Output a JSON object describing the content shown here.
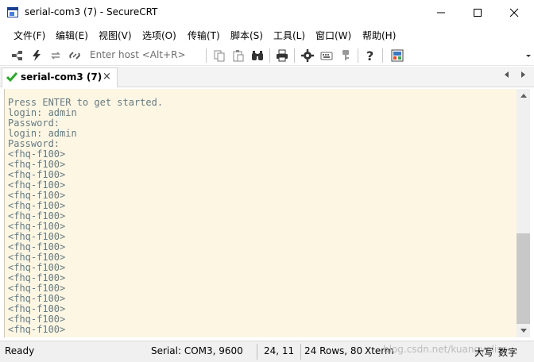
{
  "window": {
    "title": "serial-com3 (7) - SecureCRT",
    "minimize_icon": "minimize-icon",
    "maximize_icon": "maximize-icon",
    "close_icon": "close-icon"
  },
  "menu": {
    "items": [
      {
        "label": "文件(F)"
      },
      {
        "label": "编辑(E)"
      },
      {
        "label": "视图(V)"
      },
      {
        "label": "选项(O)"
      },
      {
        "label": "传输(T)"
      },
      {
        "label": "脚本(S)"
      },
      {
        "label": "工具(L)"
      },
      {
        "label": "窗口(W)"
      },
      {
        "label": "帮助(H)"
      }
    ]
  },
  "toolbar": {
    "host_hint": "Enter host <Alt+R>",
    "icons": [
      "connect-icon",
      "quick-connect-icon",
      "reconnect-icon",
      "disconnect-icon",
      "copy-icon",
      "paste-icon",
      "find-icon",
      "print-icon",
      "settings-icon",
      "keymap-icon",
      "sftp-icon",
      "help-icon",
      "screenshot-icon"
    ]
  },
  "tab": {
    "label": "serial-com3 (7)",
    "close": "×",
    "status_color": "#2aa82a"
  },
  "terminal": {
    "background": "#fdf6e3",
    "foreground": "#657b83",
    "lines": [
      "Press ENTER to get started.",
      "login: admin",
      "Password:",
      "login: admin",
      "Password:",
      "<fhq-f100>",
      "<fhq-f100>",
      "<fhq-f100>",
      "<fhq-f100>",
      "<fhq-f100>",
      "<fhq-f100>",
      "<fhq-f100>",
      "<fhq-f100>",
      "<fhq-f100>",
      "<fhq-f100>",
      "<fhq-f100>",
      "<fhq-f100>",
      "<fhq-f100>",
      "<fhq-f100>",
      "<fhq-f100>",
      "<fhq-f100>",
      "<fhq-f100>",
      "<fhq-f100>"
    ]
  },
  "status": {
    "ready": "Ready",
    "connection": "Serial: COM3, 9600",
    "cursor": "24,  11",
    "size": "24 Rows, 80",
    "emulation": "Xterm",
    "caps": "大写",
    "num": "数字",
    "watermark": "blog.csdn.net/kuangyelisa"
  }
}
